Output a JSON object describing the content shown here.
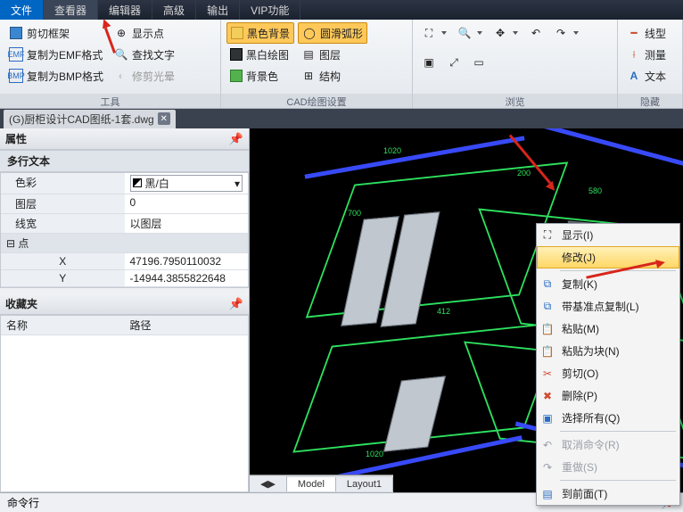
{
  "menubar": {
    "file": "文件",
    "viewer": "查看器",
    "editor": "编辑器",
    "advanced": "高级",
    "output": "输出",
    "vip": "VIP功能"
  },
  "ribbon": {
    "group_tools_label": "工具",
    "group_cad_label": "CAD绘图设置",
    "group_browse_label": "浏览",
    "group_hide_label": "隐藏",
    "crop_frame": "剪切框架",
    "copy_emf": "复制为EMF格式",
    "copy_bmp": "复制为BMP格式",
    "show_point": "显示点",
    "find_text": "查找文字",
    "trim_halo": "修剪光晕",
    "black_bg": "黑色背景",
    "bw_draw": "黑白绘图",
    "bg_color": "背景色",
    "smooth_arc": "圆滑弧形",
    "layer": "图层",
    "structure": "结构",
    "line_type": "线型",
    "measure": "测量",
    "text": "文本"
  },
  "doc": {
    "tab_name": "(G)厨柜设计CAD图纸-1套.dwg"
  },
  "panel": {
    "props_title": "属性",
    "favorites_title": "收藏夹",
    "type_header": "多行文本",
    "color_label": "色彩",
    "color_value": "黑/白",
    "layer_label": "图层",
    "layer_value": "0",
    "lineweight_label": "线宽",
    "lineweight_value": "以图层",
    "point_section": "点",
    "x_label": "X",
    "x_value": "47196.7950110032",
    "y_label": "Y",
    "y_value": "-14944.3855822648",
    "fav_name": "名称",
    "fav_path": "路径"
  },
  "ctx": {
    "display": "显示(I)",
    "modify": "修改(J)",
    "copy": "复制(K)",
    "copy_base": "带基准点复制(L)",
    "paste": "粘贴(M)",
    "paste_block": "粘贴为块(N)",
    "cut": "剪切(O)",
    "delete": "删除(P)",
    "select_all": "选择所有(Q)",
    "cancel_cmd": "取消命令(R)",
    "redo": "重做(S)",
    "to_front": "到前面(T)"
  },
  "tabs": {
    "model": "Model",
    "layout1": "Layout1"
  },
  "cmd": {
    "title": "命令行"
  }
}
